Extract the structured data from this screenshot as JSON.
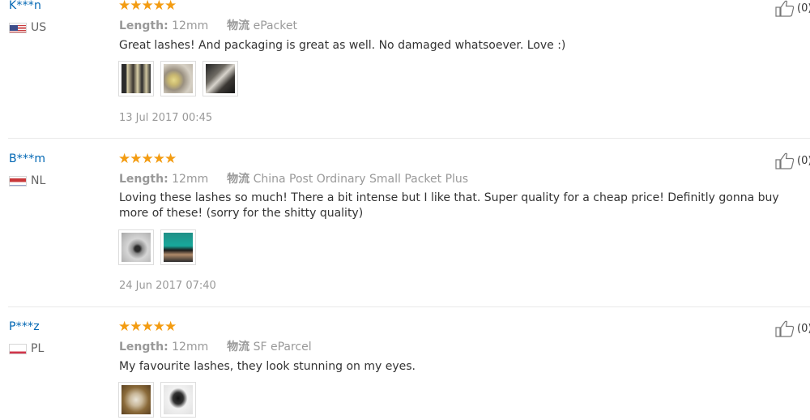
{
  "reviews": [
    {
      "user": "K***n",
      "country": "US",
      "rating": 5,
      "stars": "★★★★★",
      "length_label": "Length:",
      "length_value": "12mm",
      "shipping_label": "物流",
      "shipping_value": "ePacket",
      "text": "Great lashes! And packaging is great as well. No damaged whatsoever. Love :)",
      "date": "13 Jul 2017 00:45",
      "helpful_count": "(0)"
    },
    {
      "user": "B***m",
      "country": "NL",
      "rating": 5,
      "stars": "★★★★★",
      "length_label": "Length:",
      "length_value": "12mm",
      "shipping_label": "物流",
      "shipping_value": "China Post Ordinary Small Packet Plus",
      "text": "Loving these lashes so much! There a bit intense but I like that. Super quality for a cheap price! Definitly gonna buy more of these! (sorry for the shitty quality)",
      "date": "24 Jun 2017 07:40",
      "helpful_count": "(0)"
    },
    {
      "user": "P***z",
      "country": "PL",
      "rating": 5,
      "stars": "★★★★★",
      "length_label": "Length:",
      "length_value": "12mm",
      "shipping_label": "物流",
      "shipping_value": "SF eParcel",
      "text": "My favourite lashes, they look stunning on my eyes.",
      "helpful_count": "(0)"
    }
  ],
  "icons": {
    "helpful": "thumbs-up-icon",
    "flag_us": "us-flag-icon",
    "flag_nl": "nl-flag-icon",
    "flag_pl": "pl-flag-icon"
  },
  "colors": {
    "username": "#0066b3",
    "star": "#f39c12",
    "muted": "#999999"
  }
}
